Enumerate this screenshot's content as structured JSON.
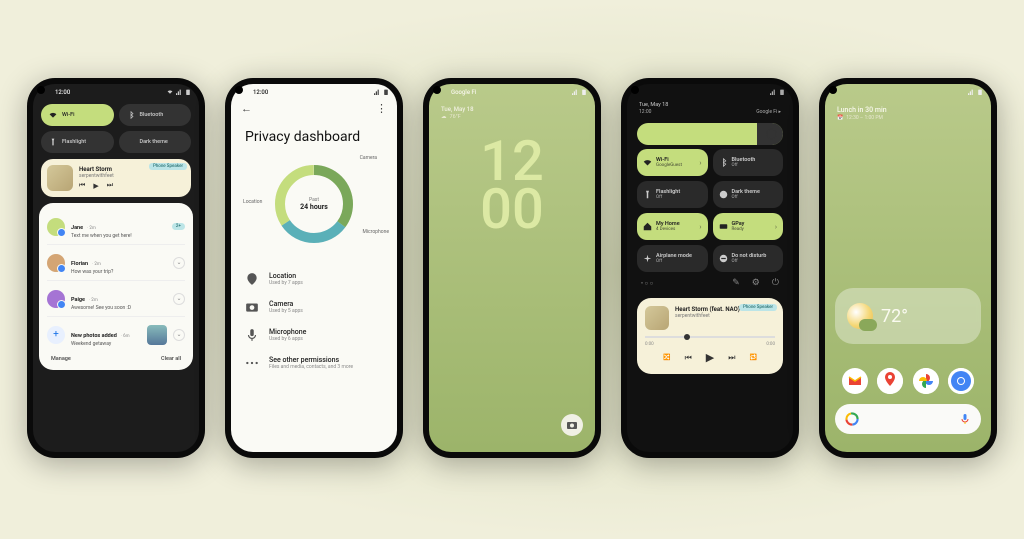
{
  "colors": {
    "accent": "#c4dd7d",
    "bgDark": "#1c1c1c",
    "bgLight": "#fafaf5"
  },
  "status": {
    "time": "12:00",
    "carrier": "Google Fi"
  },
  "phone1": {
    "tiles": [
      {
        "label": "Wi-Fi",
        "active": true
      },
      {
        "label": "Bluetooth",
        "active": false
      },
      {
        "label": "Flashlight",
        "active": false
      },
      {
        "label": "Dark theme",
        "active": false
      }
    ],
    "media": {
      "title": "Heart Storm",
      "artist": "serpentwithfeet",
      "badge": "Phone Speaker"
    },
    "notifications": [
      {
        "name": "Jane",
        "meta": "2m",
        "msg": "Text me when you get here!",
        "badge": "2+"
      },
      {
        "name": "Florian",
        "meta": "2m",
        "msg": "How was your trip?",
        "badge": ""
      },
      {
        "name": "Paige",
        "meta": "2m",
        "msg": "Awesome! See you soon :D",
        "badge": ""
      }
    ],
    "photo_notif": {
      "title": "New photos added",
      "meta": "6m",
      "sub": "Weekend getaway"
    },
    "footer": {
      "manage": "Manage",
      "clear": "Clear all"
    }
  },
  "phone2": {
    "title": "Privacy dashboard",
    "chart_center_top": "Past",
    "chart_center": "24 hours",
    "seg_labels": {
      "location": "Location",
      "camera": "Camera",
      "microphone": "Microphone"
    },
    "perms": [
      {
        "title": "Location",
        "sub": "Used by 7 apps"
      },
      {
        "title": "Camera",
        "sub": "Used by 5 apps"
      },
      {
        "title": "Microphone",
        "sub": "Used by 6 apps"
      },
      {
        "title": "See other permissions",
        "sub": "Files and media, contacts, and 3 more"
      }
    ]
  },
  "phone3": {
    "date": "Tue, May 18",
    "weather": "76°F",
    "clock_h": "12",
    "clock_m": "00"
  },
  "phone4": {
    "date": "Tue, May 18",
    "sub_time": "12:00",
    "sub_carrier": "Google Fi",
    "tiles": [
      {
        "title": "Wi-Fi",
        "sub": "GoogleGuest",
        "on": true,
        "chev": true
      },
      {
        "title": "Bluetooth",
        "sub": "Off",
        "on": false
      },
      {
        "title": "Flashlight",
        "sub": "Off",
        "on": false
      },
      {
        "title": "Dark theme",
        "sub": "Off",
        "on": false
      },
      {
        "title": "My Home",
        "sub": "4 Devices",
        "on": true,
        "chev": true
      },
      {
        "title": "GPay",
        "sub": "Ready",
        "on": true,
        "chev": true
      },
      {
        "title": "Airplane mode",
        "sub": "Off",
        "on": false
      },
      {
        "title": "Do not disturb",
        "sub": "Off",
        "on": false
      }
    ],
    "media": {
      "title": "Heart Storm (feat. NAO)",
      "artist": "serpentwithfeet",
      "badge": "Phone Speaker",
      "t0": "0:00",
      "t1": "0:00"
    }
  },
  "phone5": {
    "event": "Lunch in 30 min",
    "event_time": "12:30 – 1:00 PM",
    "temp": "72°"
  }
}
